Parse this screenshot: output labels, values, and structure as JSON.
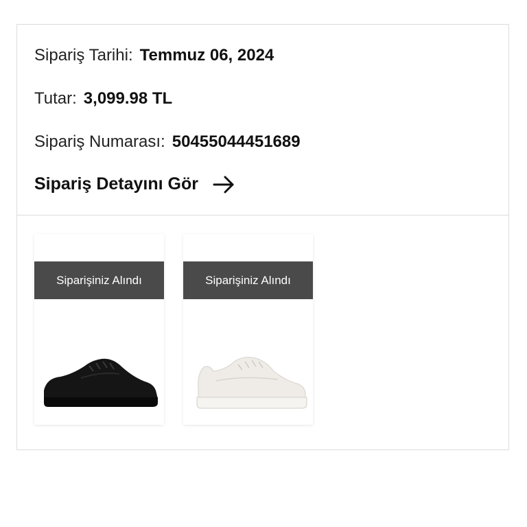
{
  "order": {
    "date_label": "Sipariş Tarihi:",
    "date_value": "Temmuz 06, 2024",
    "amount_label": "Tutar:",
    "amount_value": "3,099.98 TL",
    "number_label": "Sipariş Numarası:",
    "number_value": "50455044451689",
    "detail_link": "Sipariş Detayını Gör"
  },
  "icons": {
    "detail_link": "arrow-right-icon"
  },
  "products": [
    {
      "status": "Siparişiniz Alındı",
      "image": "black sneaker",
      "color": "#111111"
    },
    {
      "status": "Siparişiniz Alındı",
      "image": "white sneaker",
      "color": "#f1efec"
    }
  ],
  "colors": {
    "badge_bg": "#4a4a4a",
    "border": "#dcdcdc"
  }
}
